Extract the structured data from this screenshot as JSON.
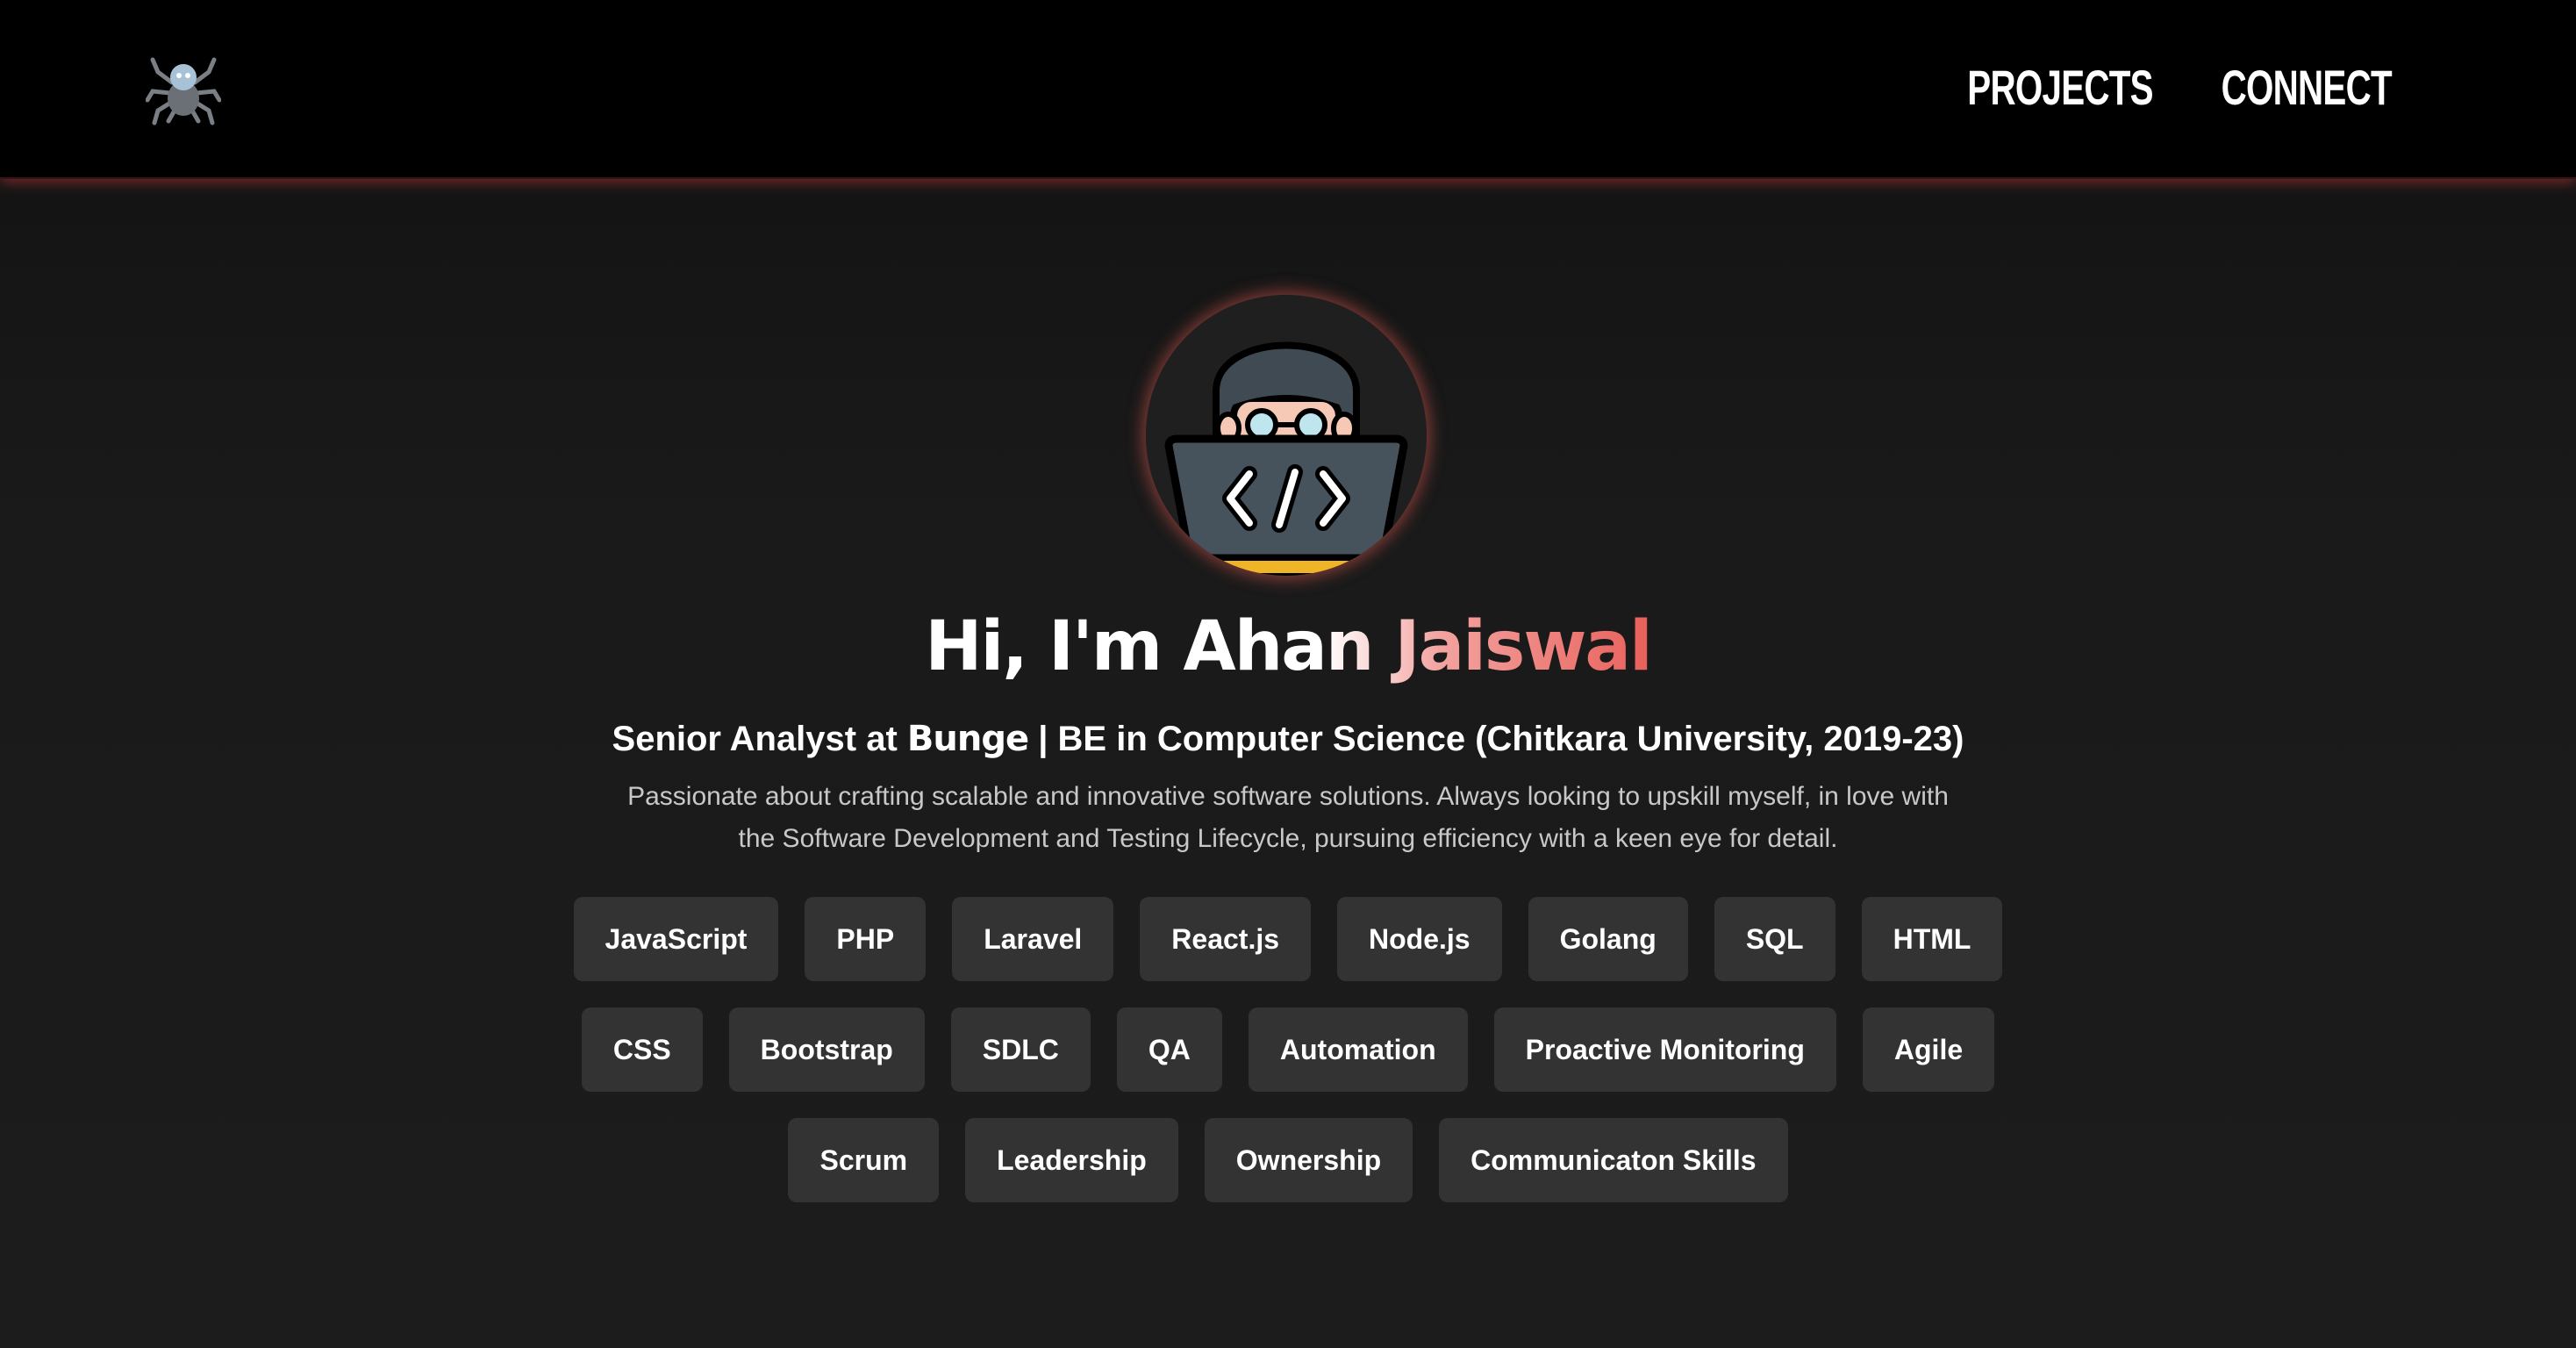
{
  "nav": {
    "logo_icon": "spider-icon",
    "links": [
      "PROJECTS",
      "CONNECT"
    ]
  },
  "hero": {
    "avatar_icon": "developer-with-laptop-icon",
    "title_prefix": "Hi, I'm ",
    "title_name": "Ahan Jaiswal",
    "subtitle_pre": "Senior Analyst at ",
    "subtitle_company": "Bunge",
    "subtitle_post": " | BE in Computer Science (Chitkara University, 2019-23)",
    "description": "Passionate about crafting scalable and innovative software solutions. Always looking to upskill myself, in love with the Software Development and Testing Lifecycle, pursuing efficiency with a keen eye for detail."
  },
  "skills": {
    "row1": [
      "JavaScript",
      "PHP",
      "Laravel",
      "React.js",
      "Node.js",
      "Golang",
      "SQL",
      "HTML"
    ],
    "row2": [
      "CSS",
      "Bootstrap",
      "SDLC",
      "QA",
      "Automation",
      "Proactive Monitoring",
      "Agile"
    ],
    "row3": [
      "Scrum",
      "Leadership",
      "Ownership",
      "Communicaton Skills"
    ]
  },
  "colors": {
    "nav_bg": "#000000",
    "page_bg": "#1a1a1a",
    "chip_bg": "#333333",
    "accent": "#e8605a",
    "glow": "#dc5a50"
  }
}
